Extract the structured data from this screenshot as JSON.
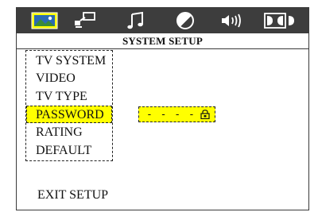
{
  "toolbar": {
    "icons": [
      "picture-icon",
      "language-icon",
      "audio-music-icon",
      "video-adjust-icon",
      "speaker-icon",
      "dolby-icon"
    ]
  },
  "screen": {
    "title": "SYSTEM SETUP"
  },
  "menu": {
    "items": [
      "TV SYSTEM",
      "VIDEO",
      "TV TYPE",
      "PASSWORD",
      "RATING",
      "DEFAULT"
    ],
    "selected_index": 3
  },
  "password": {
    "value": "- - - -"
  },
  "exit_label": "EXIT SETUP",
  "colors": {
    "highlight": "#ffff00",
    "toolbar": "#3d3d3d",
    "icon": "#ffffff"
  }
}
